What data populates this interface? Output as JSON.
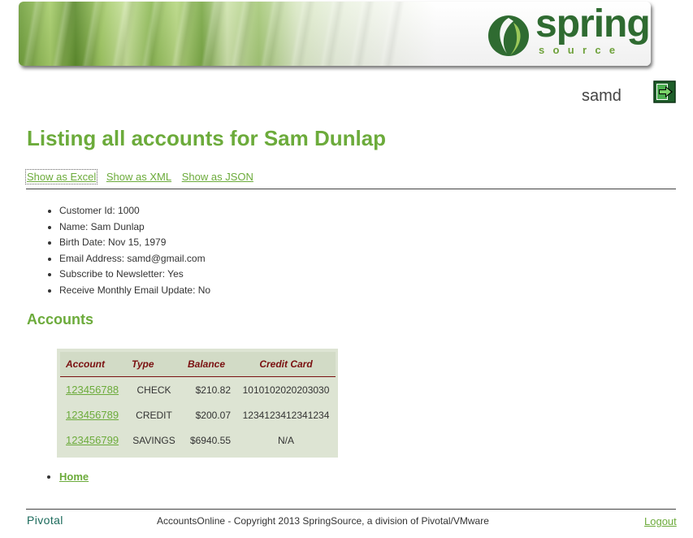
{
  "header": {
    "logo_word": "spring",
    "logo_sub": "source",
    "username": "samd"
  },
  "page": {
    "title": "Listing all accounts for Sam Dunlap",
    "formats": [
      "Show as Excel",
      "Show as XML",
      "Show as JSON"
    ]
  },
  "customer": {
    "items": [
      "Customer Id: 1000",
      "Name: Sam Dunlap",
      "Birth Date: Nov 15, 1979",
      "Email Address: samd@gmail.com",
      "Subscribe to Newsletter: Yes",
      "Receive Monthly Email Update: No"
    ]
  },
  "accounts": {
    "heading": "Accounts",
    "columns": [
      "Account",
      "Type",
      "Balance",
      "Credit Card"
    ],
    "rows": [
      {
        "account": "123456788",
        "type": "CHECK",
        "balance": "$210.82",
        "credit_card": "1010102020203030"
      },
      {
        "account": "123456789",
        "type": "CREDIT",
        "balance": "$200.07",
        "credit_card": "1234123412341234"
      },
      {
        "account": "123456799",
        "type": "SAVINGS",
        "balance": "$6940.55",
        "credit_card": "N/A"
      }
    ]
  },
  "nav": {
    "home_label": "Home"
  },
  "footer": {
    "brand": "Pivotal",
    "copyright": "AccountsOnline - Copyright 2013 SpringSource, a division of Pivotal/VMware",
    "logout_label": "Logout"
  },
  "colors": {
    "accent_green": "#6cab3b",
    "header_red": "#7a1010",
    "table_bg": "#dde4d3"
  }
}
